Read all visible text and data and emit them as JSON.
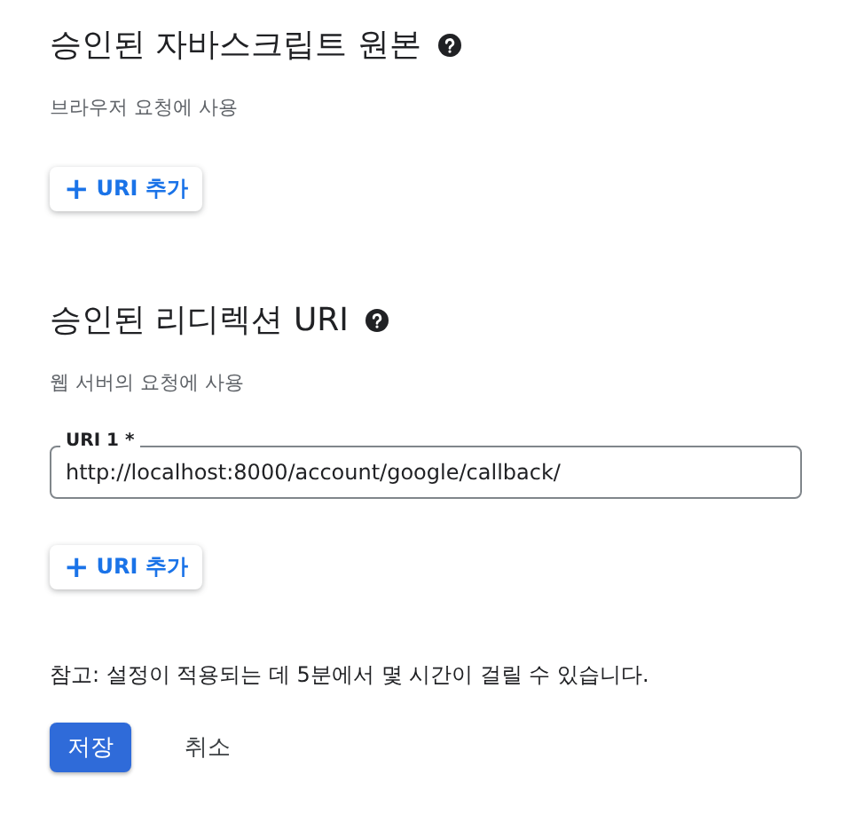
{
  "sections": [
    {
      "title": "승인된 자바스크립트 원본",
      "subtitle": "브라우저 요청에 사용",
      "add_button": {
        "icon": "+",
        "label": "URI 추가"
      }
    },
    {
      "title": "승인된 리디렉션 URI",
      "subtitle": "웹 서버의 요청에 사용",
      "fields": [
        {
          "label": "URI 1 *",
          "value": "http://localhost:8000/account/google/callback/"
        }
      ],
      "add_button": {
        "icon": "+",
        "label": "URI 추가"
      }
    }
  ],
  "note": "참고: 설정이 적용되는 데 5분에서 몇 시간이 걸릴 수 있습니다.",
  "buttons": [
    {
      "label": "저장",
      "kind": "primary"
    },
    {
      "label": "취소",
      "kind": "text"
    }
  ]
}
